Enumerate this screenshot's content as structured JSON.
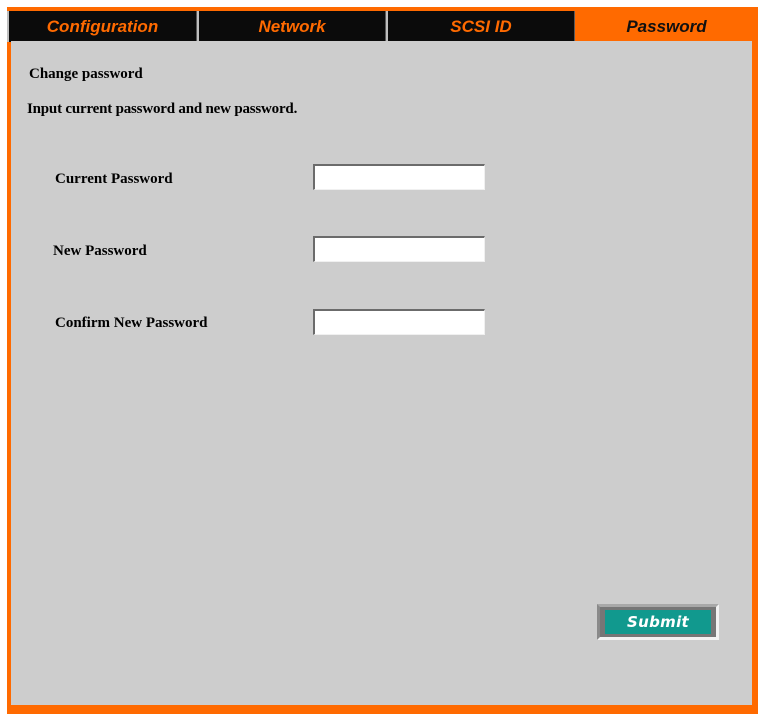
{
  "tabs": [
    {
      "label": "Configuration",
      "active": false
    },
    {
      "label": "Network",
      "active": false
    },
    {
      "label": "SCSI ID",
      "active": false
    },
    {
      "label": "Password",
      "active": true
    }
  ],
  "content": {
    "heading": "Change password",
    "instructions": "Input current password and new password.",
    "fields": [
      {
        "label": "Current Password",
        "value": ""
      },
      {
        "label": "New Password",
        "value": ""
      },
      {
        "label": "Confirm New Password",
        "value": ""
      }
    ],
    "submit_label": "Submit"
  },
  "colors": {
    "accent": "#ff6a00",
    "tab_inactive_bg": "#0b0b0b",
    "panel_bg": "#cdcdcd",
    "button": "#11998e"
  }
}
